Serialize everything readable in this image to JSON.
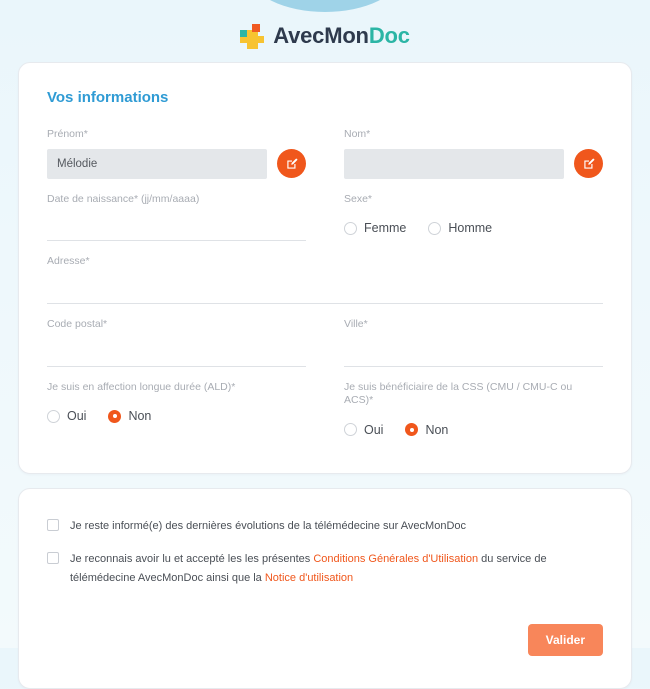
{
  "brand": {
    "name_dark": "AvecMon",
    "name_accent": "Doc",
    "logo_icon": "medical-cross-logo",
    "accent_color": "#f0571c",
    "title_color": "#2f9bd4",
    "teal_color": "#2bb5a5"
  },
  "form": {
    "section_title": "Vos informations",
    "firstname": {
      "label": "Prénom*",
      "value": "Mélodie",
      "placeholder": "",
      "edit_icon": "edit-square-icon"
    },
    "lastname": {
      "label": "Nom*",
      "value": "",
      "placeholder": "",
      "edit_icon": "edit-square-icon"
    },
    "birthdate": {
      "label": "Date de naissance* (jj/mm/aaaa)",
      "value": "",
      "placeholder": ""
    },
    "sexe": {
      "label": "Sexe*",
      "options": [
        {
          "label": "Femme",
          "checked": false
        },
        {
          "label": "Homme",
          "checked": false
        }
      ]
    },
    "address": {
      "label": "Adresse*",
      "value": "",
      "placeholder": ""
    },
    "postal_code": {
      "label": "Code postal*",
      "value": "",
      "placeholder": ""
    },
    "city": {
      "label": "Ville*",
      "value": "",
      "placeholder": ""
    },
    "ald": {
      "label": "Je suis en affection longue durée (ALD)*",
      "options": [
        {
          "label": "Oui",
          "checked": false
        },
        {
          "label": "Non",
          "checked": true
        }
      ]
    },
    "css": {
      "label": "Je suis bénéficiaire de la CSS (CMU / CMU-C ou ACS)*",
      "options": [
        {
          "label": "Oui",
          "checked": false
        },
        {
          "label": "Non",
          "checked": true
        }
      ]
    }
  },
  "consents": {
    "newsletter": {
      "text": "Je reste informé(e) des dernières évolutions de la télémédecine sur AvecMonDoc",
      "checked": false
    },
    "terms": {
      "checked": false,
      "part1": "Je reconnais avoir lu et accepté les les présentes ",
      "link1": "Conditions Générales d'Utilisation",
      "part2": " du service de télémédecine AvecMonDoc ainsi que la ",
      "link2": "Notice d'utilisation"
    }
  },
  "actions": {
    "validate_label": "Valider"
  }
}
